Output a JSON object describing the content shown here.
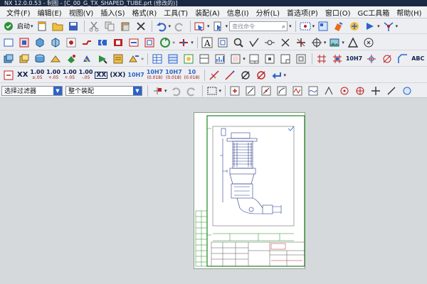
{
  "titlebar": {
    "text": "NX 12.0.0.53 - 制图 - [C_00_G_TX_SHAPED_TUBE.prt (修改的)]"
  },
  "menu": {
    "items": [
      "文件(F)",
      "编辑(E)",
      "视图(V)",
      "插入(S)",
      "格式(R)",
      "工具(T)",
      "装配(A)",
      "信息(I)",
      "分析(L)",
      "首选项(P)",
      "窗口(O)",
      "GC工具箱",
      "帮助(H)"
    ]
  },
  "toolbar": {
    "start_label": "启动",
    "search_placeholder": "查找命令",
    "tol_xx": "XX",
    "tol_100a": "1.00",
    "tol_100a_sub": "±.05",
    "tol_100b": "1.00",
    "tol_100b_sub": "+.05",
    "tol_100c": "1.00",
    "tol_100c_sub": "+.05",
    "tol_100d": "1.00",
    "tol_100d_sub": "-.05",
    "tol_xx_box": "XX",
    "tol_xx_paren": "(XX)",
    "fit_10h7": "10H7",
    "fit_10h7_a": "10H7",
    "fit_10h7_a_sub": "(0.018)",
    "fit_10h7_b": "10H7",
    "fit_10h7_b_sub": "(0.018)",
    "fit_10": "10",
    "fit_10_sub": "(0.018)",
    "abc_label": "ABC"
  },
  "filterbar": {
    "selection_filter": "选择过滤器",
    "scope": "整个装配"
  },
  "colors": {
    "accent": "#2d63c8",
    "sheet_border": "#1a8a1a",
    "titlebar": "#1b2a43"
  }
}
